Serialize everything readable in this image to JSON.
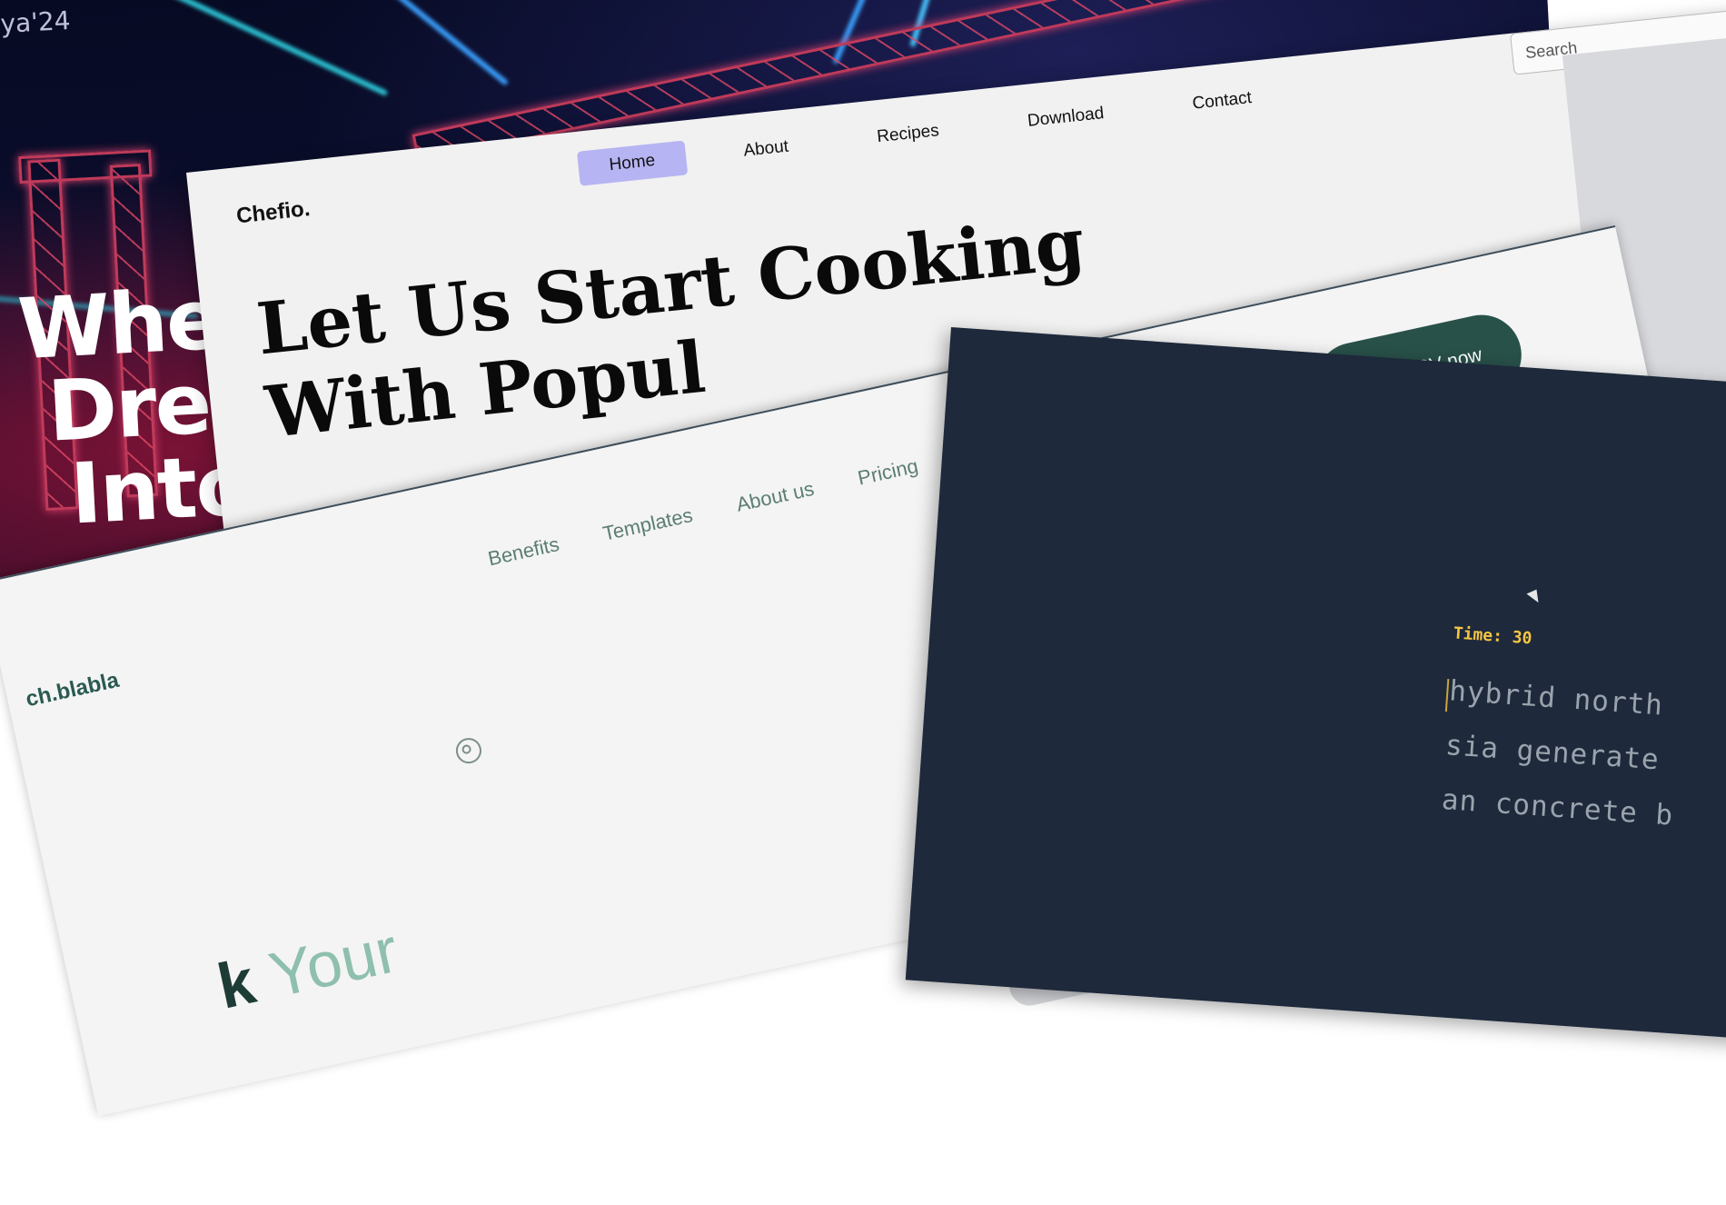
{
  "concert": {
    "tag": "ya'24",
    "headline": [
      "Wher",
      "Drea",
      "Into"
    ]
  },
  "chefio": {
    "logo": "Chefio.",
    "nav": [
      "Home",
      "About",
      "Recipes",
      "Download",
      "Contact"
    ],
    "active_nav": "Home",
    "search_placeholder": "Search",
    "hero": [
      "Let Us Start Cooking",
      "With Popul"
    ]
  },
  "cv": {
    "brand": "ch.blabla",
    "nav": [
      "Benefits",
      "Templates",
      "About us",
      "Pricing"
    ],
    "cta": "Create CV now",
    "hero_dark": "k",
    "hero_accent": "Your"
  },
  "typing": {
    "timer_label": "Time: 30",
    "lines": [
      "hybrid north",
      "sia generate",
      "an concrete b"
    ]
  },
  "colors": {
    "chefio_active": "#b7b4f3",
    "cta_bg": "#285149",
    "typing_bg": "#1e293b",
    "timer": "#f5c542"
  }
}
